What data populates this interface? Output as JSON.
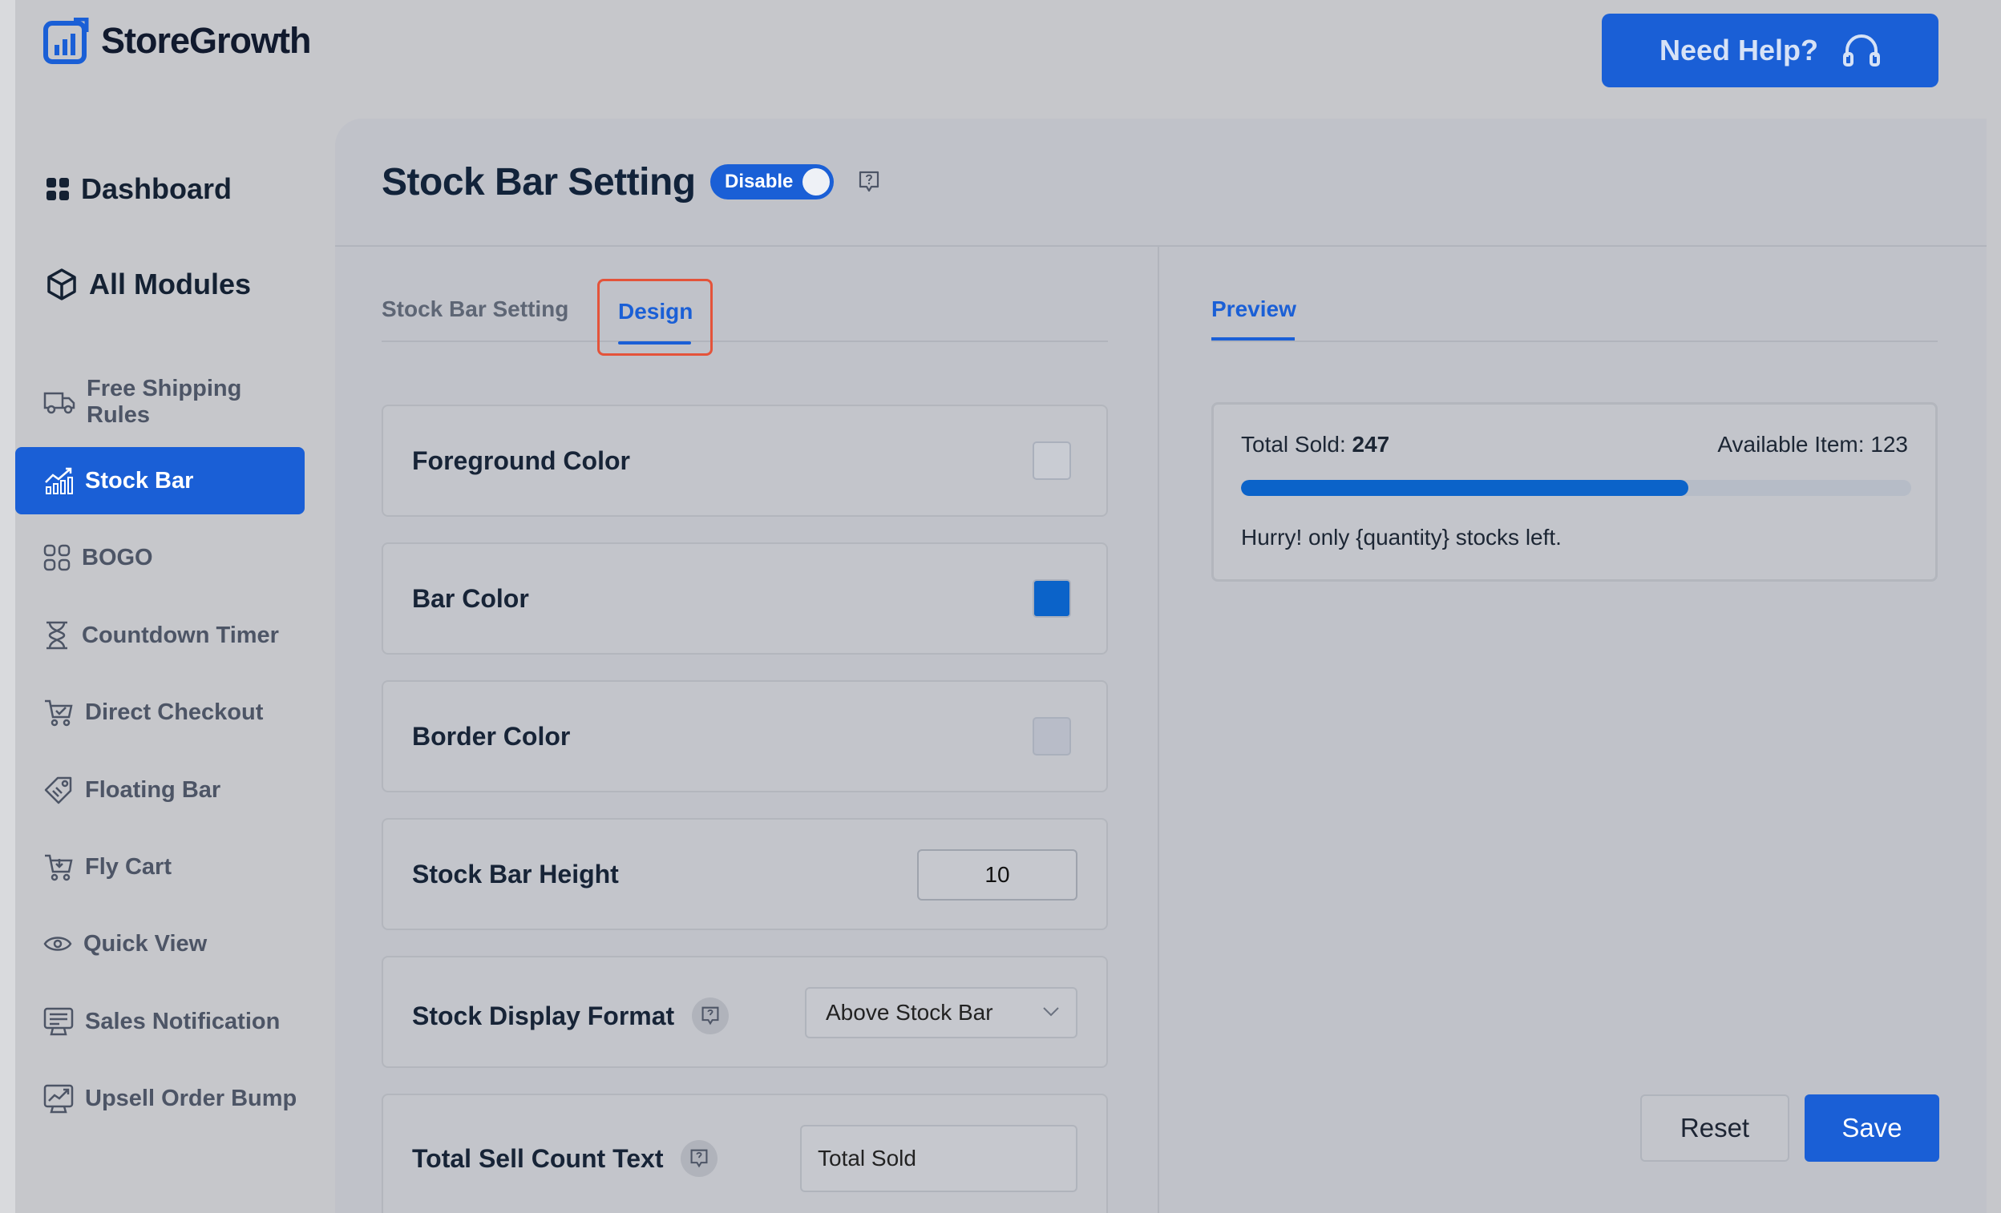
{
  "brand": {
    "name": "StoreGrowth"
  },
  "header": {
    "help_label": "Need Help?"
  },
  "sidebar": {
    "main": [
      {
        "label": "Dashboard",
        "icon": "dashboard-grid-icon"
      },
      {
        "label": "All Modules",
        "icon": "cube-icon"
      }
    ],
    "items": [
      {
        "label": "Free Shipping Rules",
        "icon": "truck-icon"
      },
      {
        "label": "Stock Bar",
        "icon": "stock-chart-icon",
        "active": true
      },
      {
        "label": "BOGO",
        "icon": "bogo-icon"
      },
      {
        "label": "Countdown Timer",
        "icon": "hourglass-icon"
      },
      {
        "label": "Direct Checkout",
        "icon": "cart-check-icon"
      },
      {
        "label": "Floating Bar",
        "icon": "tag-icon"
      },
      {
        "label": "Fly Cart",
        "icon": "cart-icon"
      },
      {
        "label": "Quick View",
        "icon": "eye-icon"
      },
      {
        "label": "Sales Notification",
        "icon": "notification-icon"
      },
      {
        "label": "Upsell Order Bump",
        "icon": "trend-chart-icon"
      }
    ]
  },
  "page": {
    "title": "Stock Bar Setting",
    "toggle_label": "Disable"
  },
  "tabs": {
    "settings_label": "Stock Bar Setting",
    "design_label": "Design",
    "preview_label": "Preview"
  },
  "design": {
    "foreground_color": {
      "label": "Foreground Color",
      "value": "#c9ccd3"
    },
    "bar_color": {
      "label": "Bar Color",
      "value": "#0b63c9"
    },
    "border_color": {
      "label": "Border Color",
      "value": "#b8bcc8"
    },
    "stock_bar_height": {
      "label": "Stock Bar Height",
      "value": "10"
    },
    "stock_display_format": {
      "label": "Stock Display Format",
      "value": "Above Stock Bar"
    },
    "total_sell_count_text": {
      "label": "Total Sell Count Text",
      "value": "Total Sold"
    }
  },
  "preview": {
    "sold_label": "Total Sold:",
    "sold_value": "247",
    "available_label": "Available Item:",
    "available_value": "123",
    "progress_fraction": 0.667,
    "message": "Hurry! only {quantity} stocks left."
  },
  "actions": {
    "reset_label": "Reset",
    "save_label": "Save"
  },
  "colors": {
    "accent": "#1a5fd6",
    "active_tab_outline": "#e4533a"
  }
}
